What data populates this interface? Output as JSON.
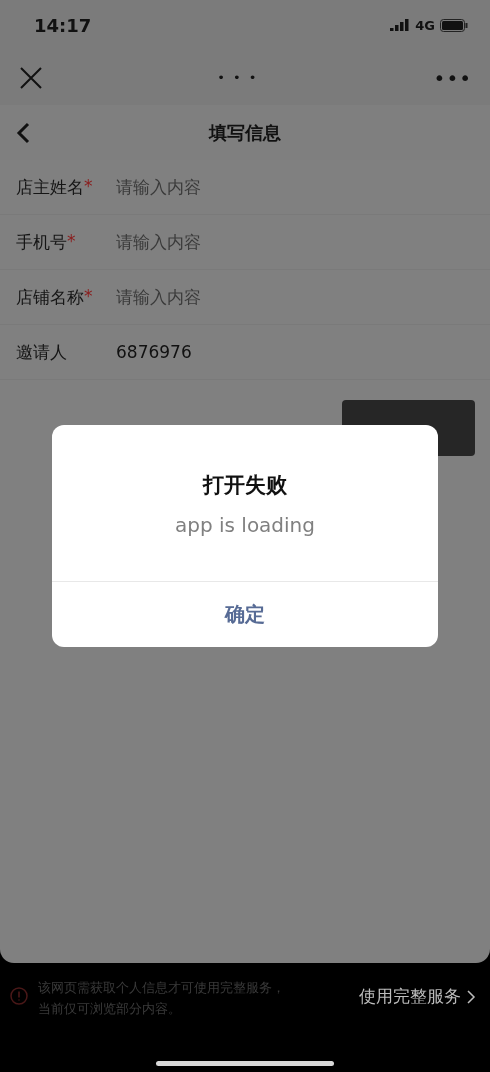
{
  "status_bar": {
    "time": "14:17",
    "network": "4G"
  },
  "browser_bar": {
    "title": "• • •",
    "menu": "•••"
  },
  "header": {
    "title": "填写信息"
  },
  "form": {
    "fields": [
      {
        "label": "店主姓名",
        "required_mark": "*",
        "placeholder": "请输入内容"
      },
      {
        "label": "手机号",
        "required_mark": "*",
        "placeholder": "请输入内容"
      },
      {
        "label": "店铺名称",
        "required_mark": "*",
        "placeholder": "请输入内容"
      },
      {
        "label": "邀请人",
        "value": "6876976"
      }
    ]
  },
  "dialog": {
    "title": "打开失败",
    "message": "app is loading",
    "button": "确定"
  },
  "notice": {
    "lines": [
      "该网页需获取个人信息才可使用完整服务，",
      "当前仅可浏览部分内容。"
    ],
    "link": "使用完整服务"
  }
}
